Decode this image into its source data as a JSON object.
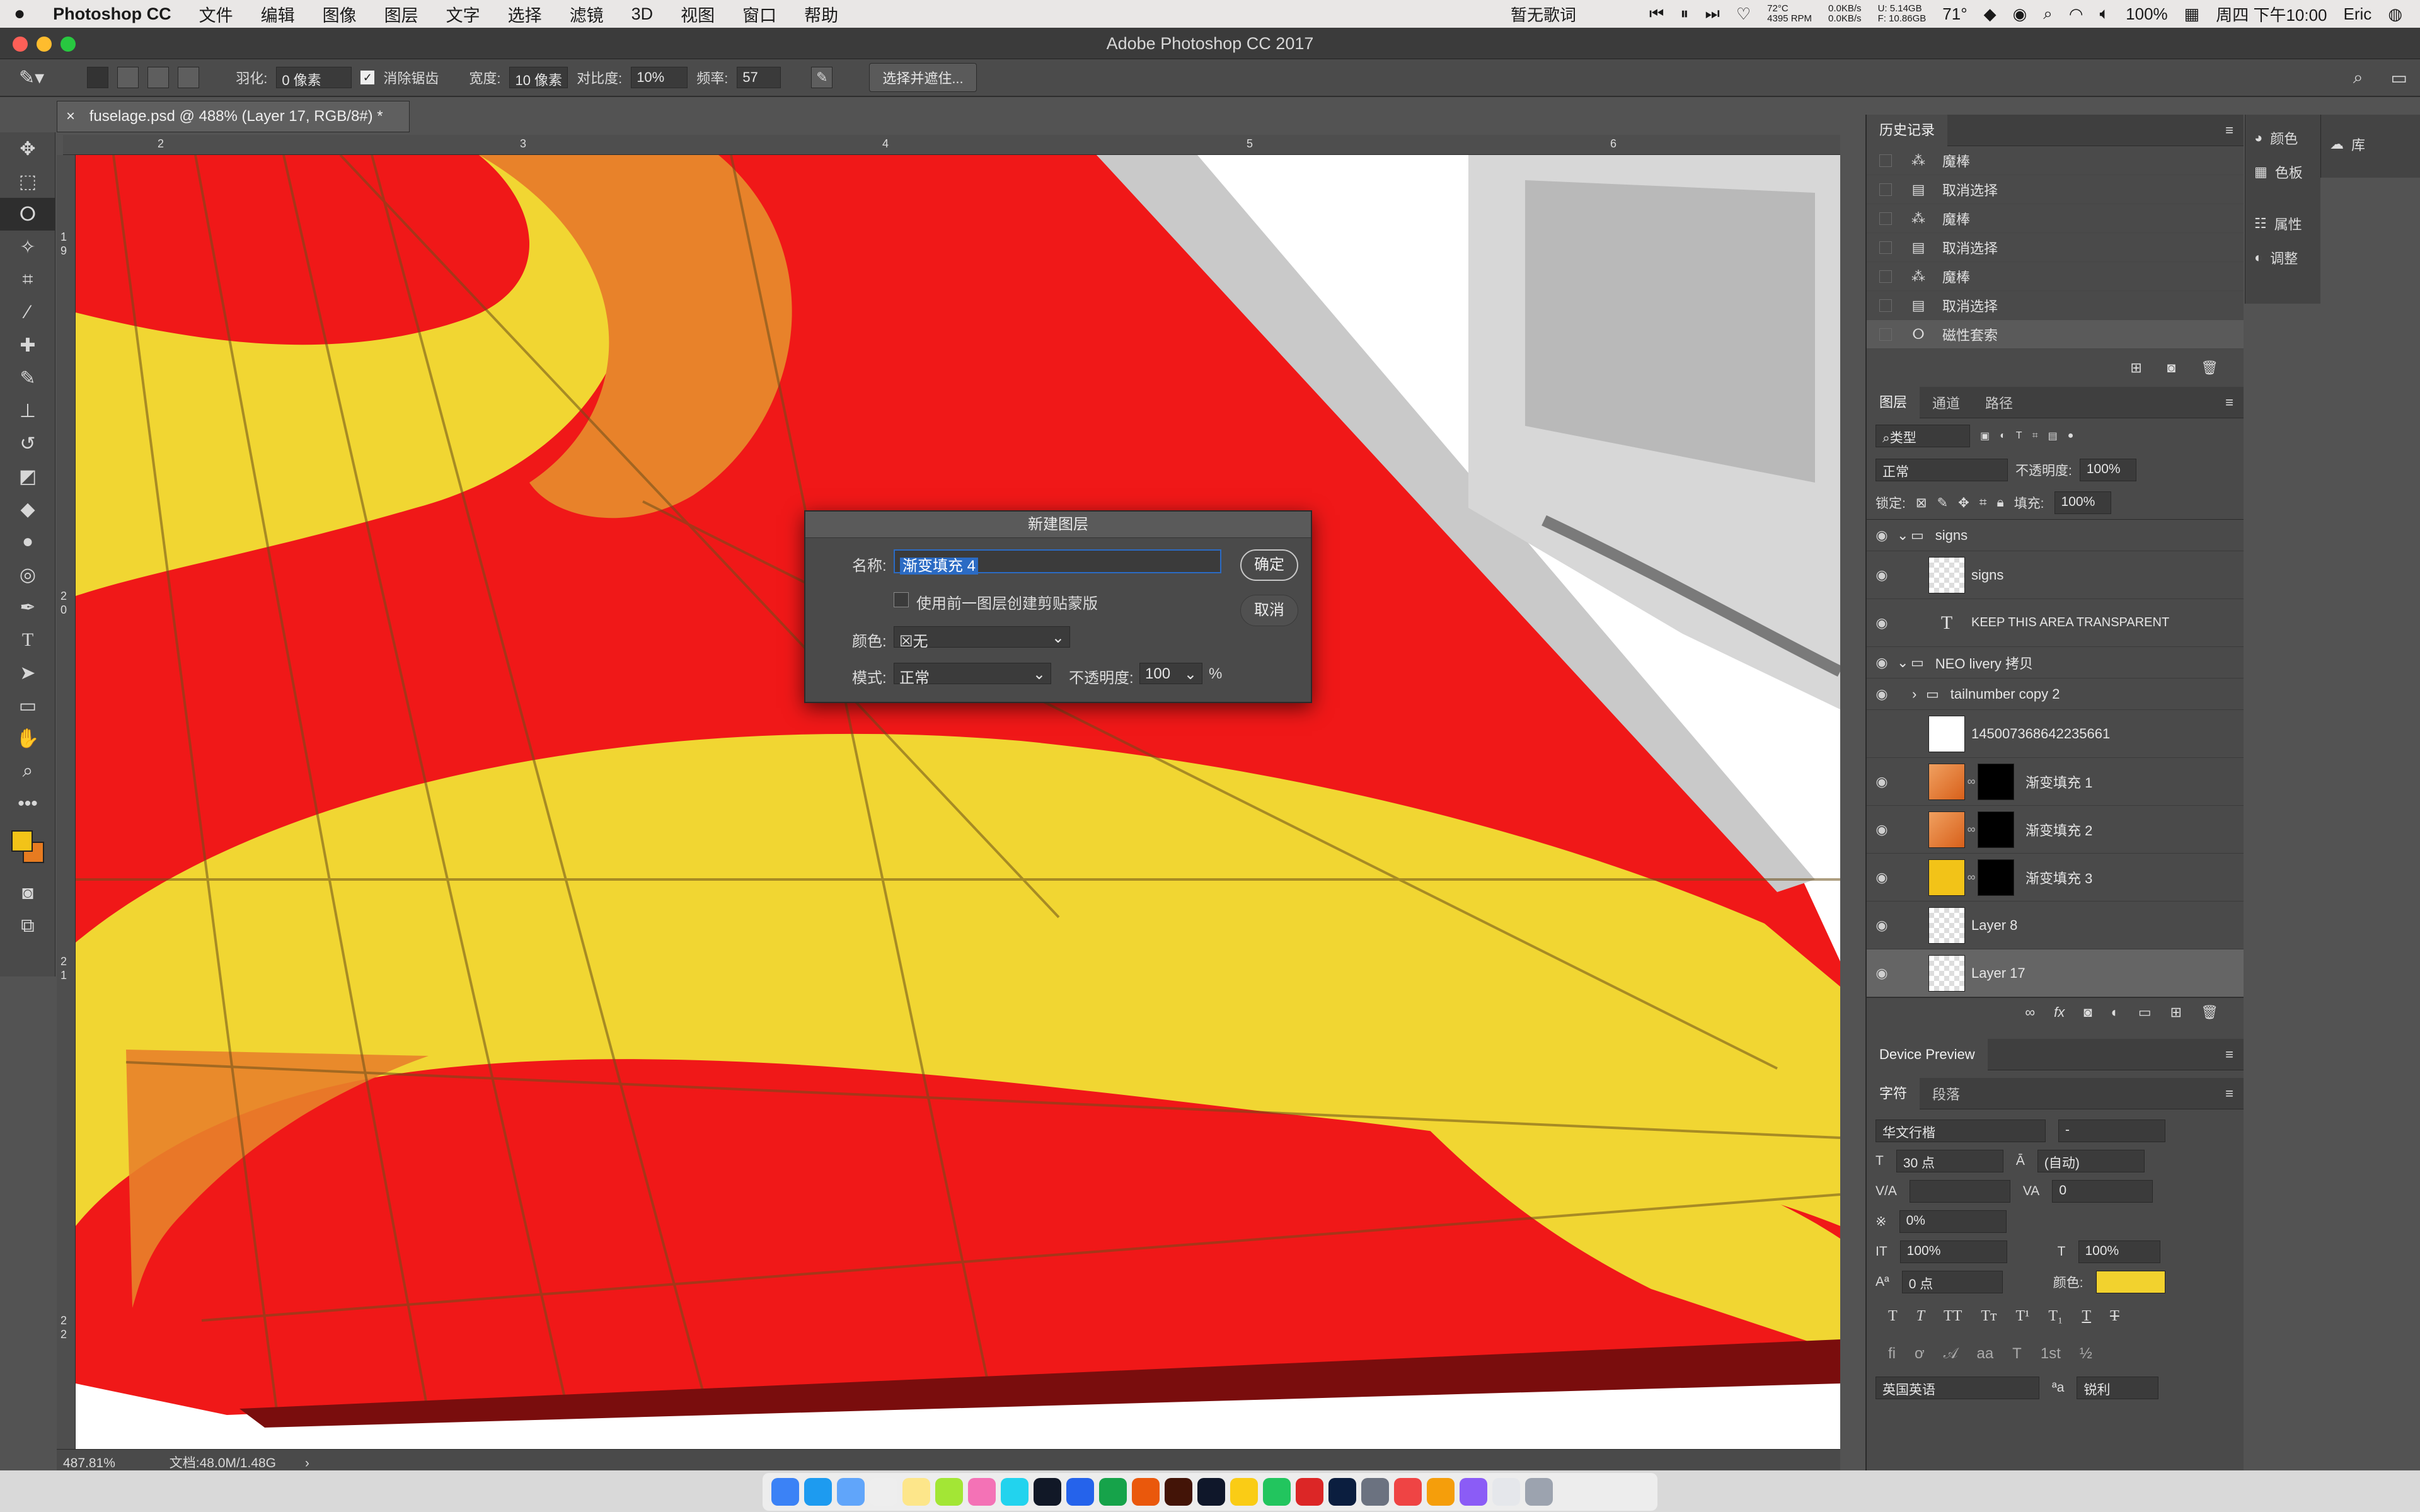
{
  "menubar": {
    "app": "Photoshop CC",
    "items": [
      "文件",
      "编辑",
      "图像",
      "图层",
      "文字",
      "选择",
      "滤镜",
      "3D",
      "视图",
      "窗口",
      "帮助"
    ],
    "now_playing": "暂无歌词",
    "cpu_temp": "72°C",
    "fan": "4395 RPM",
    "net_up": "0.0KB/s",
    "net_down": "0.0KB/s",
    "mem_used": "U: 5.14GB",
    "mem_free": "F: 10.86GB",
    "weather": "71°",
    "battery": "100%",
    "clock": "周四 下午10:00",
    "user": "Eric"
  },
  "window": {
    "title": "Adobe Photoshop CC 2017"
  },
  "options": {
    "feather_label": "羽化:",
    "feather_value": "0 像素",
    "antialias_label": "消除锯齿",
    "width_label": "宽度:",
    "width_value": "10 像素",
    "contrast_label": "对比度:",
    "contrast_value": "10%",
    "freq_label": "频率:",
    "freq_value": "57",
    "select_mask_btn": "选择并遮住..."
  },
  "document": {
    "tab": "fuselage.psd @ 488% (Layer 17, RGB/8#) *"
  },
  "ruler": {
    "h_labels": [
      "2",
      "3",
      "4",
      "5",
      "6"
    ],
    "v_labels": [
      "1",
      "9",
      "2",
      "0",
      "2",
      "1",
      "2",
      "2"
    ]
  },
  "dialog": {
    "title": "新建图层",
    "name_label": "名称:",
    "name_value": "渐变填充 4",
    "clip_label": "使用前一图层创建剪贴蒙版",
    "color_label": "颜色:",
    "color_value": "无",
    "mode_label": "模式:",
    "mode_value": "正常",
    "opacity_label": "不透明度:",
    "opacity_value": "100",
    "opacity_unit": "%",
    "ok": "确定",
    "cancel": "取消"
  },
  "history": {
    "tab": "历史记录",
    "items": [
      {
        "icon": "magic-wand-icon",
        "label": "魔棒"
      },
      {
        "icon": "document-icon",
        "label": "取消选择"
      },
      {
        "icon": "magic-wand-icon",
        "label": "魔棒"
      },
      {
        "icon": "document-icon",
        "label": "取消选择"
      },
      {
        "icon": "magic-wand-icon",
        "label": "魔棒"
      },
      {
        "icon": "document-icon",
        "label": "取消选择"
      },
      {
        "icon": "magnetic-lasso-icon",
        "label": "磁性套索"
      }
    ]
  },
  "side_buttons": {
    "color": "颜色",
    "swatches": "色板",
    "properties": "属性",
    "adjustments": "调整",
    "library": "库"
  },
  "layers": {
    "tabs": [
      "图层",
      "通道",
      "路径"
    ],
    "filter_kind": "类型",
    "blend_mode": "正常",
    "opacity_label": "不透明度:",
    "opacity_value": "100%",
    "lock_label": "锁定:",
    "fill_label": "填充:",
    "fill_value": "100%",
    "rows": [
      {
        "name": "signs",
        "type": "group",
        "visible": true
      },
      {
        "name": "signs",
        "type": "pixel",
        "visible": true
      },
      {
        "name": "KEEP THIS AREA TRANSPARENT",
        "type": "text",
        "visible": true
      },
      {
        "name": "NEO livery 拷贝",
        "type": "group",
        "visible": true
      },
      {
        "name": "tailnumber copy 2",
        "type": "group",
        "visible": true
      },
      {
        "name": "145007368642235661",
        "type": "pixel",
        "visible": false
      },
      {
        "name": "渐变填充 1",
        "type": "gradient",
        "visible": true
      },
      {
        "name": "渐变填充 2",
        "type": "gradient",
        "visible": true
      },
      {
        "name": "渐变填充 3",
        "type": "gradient-yellow",
        "visible": true
      },
      {
        "name": "Layer 8",
        "type": "pixel",
        "visible": true
      },
      {
        "name": "Layer 17",
        "type": "pixel",
        "visible": true
      }
    ]
  },
  "device_preview": {
    "title": "Device Preview"
  },
  "character": {
    "tabs": [
      "字符",
      "段落"
    ],
    "font": "华文行楷",
    "style": "-",
    "size": "30 点",
    "leading": "(自动)",
    "kerning": "",
    "tracking": "0",
    "scale_pct": "0%",
    "vscale": "100%",
    "hscale": "100%",
    "baseline": "0 点",
    "color_label": "颜色:",
    "color": "#f2d22e",
    "language": "英国英语",
    "aa_label": "ªa",
    "antialias": "锐利"
  },
  "status": {
    "zoom": "487.81%",
    "doc": "文档:48.0M/1.48G"
  },
  "colors": {
    "foreground": "#f2c318",
    "background": "#e77b20",
    "red": "#f01818",
    "yellow": "#f1d632"
  }
}
